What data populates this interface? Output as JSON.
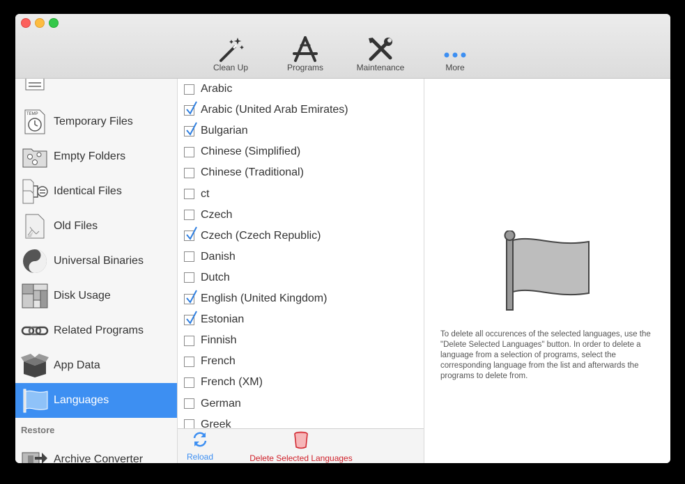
{
  "toolbar": {
    "items": [
      {
        "label": "Clean Up",
        "icon": "magic-wand-icon"
      },
      {
        "label": "Programs",
        "icon": "app-store-icon"
      },
      {
        "label": "Maintenance",
        "icon": "tools-icon"
      },
      {
        "label": "More",
        "icon": "more-dots-icon"
      }
    ]
  },
  "sidebar": {
    "items": [
      {
        "label": "Temporary Files",
        "icon": "temp-file-icon"
      },
      {
        "label": "Empty Folders",
        "icon": "empty-folder-icon"
      },
      {
        "label": "Identical Files",
        "icon": "identical-files-icon"
      },
      {
        "label": "Old Files",
        "icon": "old-file-icon"
      },
      {
        "label": "Universal Binaries",
        "icon": "universal-binary-icon"
      },
      {
        "label": "Disk Usage",
        "icon": "disk-usage-icon"
      },
      {
        "label": "Related Programs",
        "icon": "link-icon"
      },
      {
        "label": "App Data",
        "icon": "box-icon"
      },
      {
        "label": "Languages",
        "icon": "flag-icon",
        "selected": true
      }
    ],
    "section_restore": "Restore",
    "restore_items": [
      {
        "label": "Archive Converter",
        "icon": "archive-icon"
      }
    ]
  },
  "languages": [
    {
      "label": "Arabic",
      "checked": false
    },
    {
      "label": "Arabic (United Arab Emirates)",
      "checked": true
    },
    {
      "label": "Bulgarian",
      "checked": true
    },
    {
      "label": "Chinese (Simplified)",
      "checked": false
    },
    {
      "label": "Chinese (Traditional)",
      "checked": false
    },
    {
      "label": "ct",
      "checked": false
    },
    {
      "label": "Czech",
      "checked": false
    },
    {
      "label": "Czech (Czech Republic)",
      "checked": true
    },
    {
      "label": "Danish",
      "checked": false
    },
    {
      "label": "Dutch",
      "checked": false
    },
    {
      "label": "English (United Kingdom)",
      "checked": true
    },
    {
      "label": "Estonian",
      "checked": true
    },
    {
      "label": "Finnish",
      "checked": false
    },
    {
      "label": "French",
      "checked": false
    },
    {
      "label": "French (XM)",
      "checked": false
    },
    {
      "label": "German",
      "checked": false
    },
    {
      "label": "Greek",
      "checked": false
    }
  ],
  "footer": {
    "reload_label": "Reload",
    "delete_label": "Delete Selected Languages"
  },
  "detail": {
    "description": "To delete all occurences of the selected languages, use the \"Delete Selected Languages\" button. In order to delete a language from a selection of programs, select the corresponding language from the list and afterwards the programs to delete from."
  },
  "colors": {
    "accent": "#3d8ff2",
    "checkmark": "#2f7fe0",
    "delete": "#d0212a"
  }
}
